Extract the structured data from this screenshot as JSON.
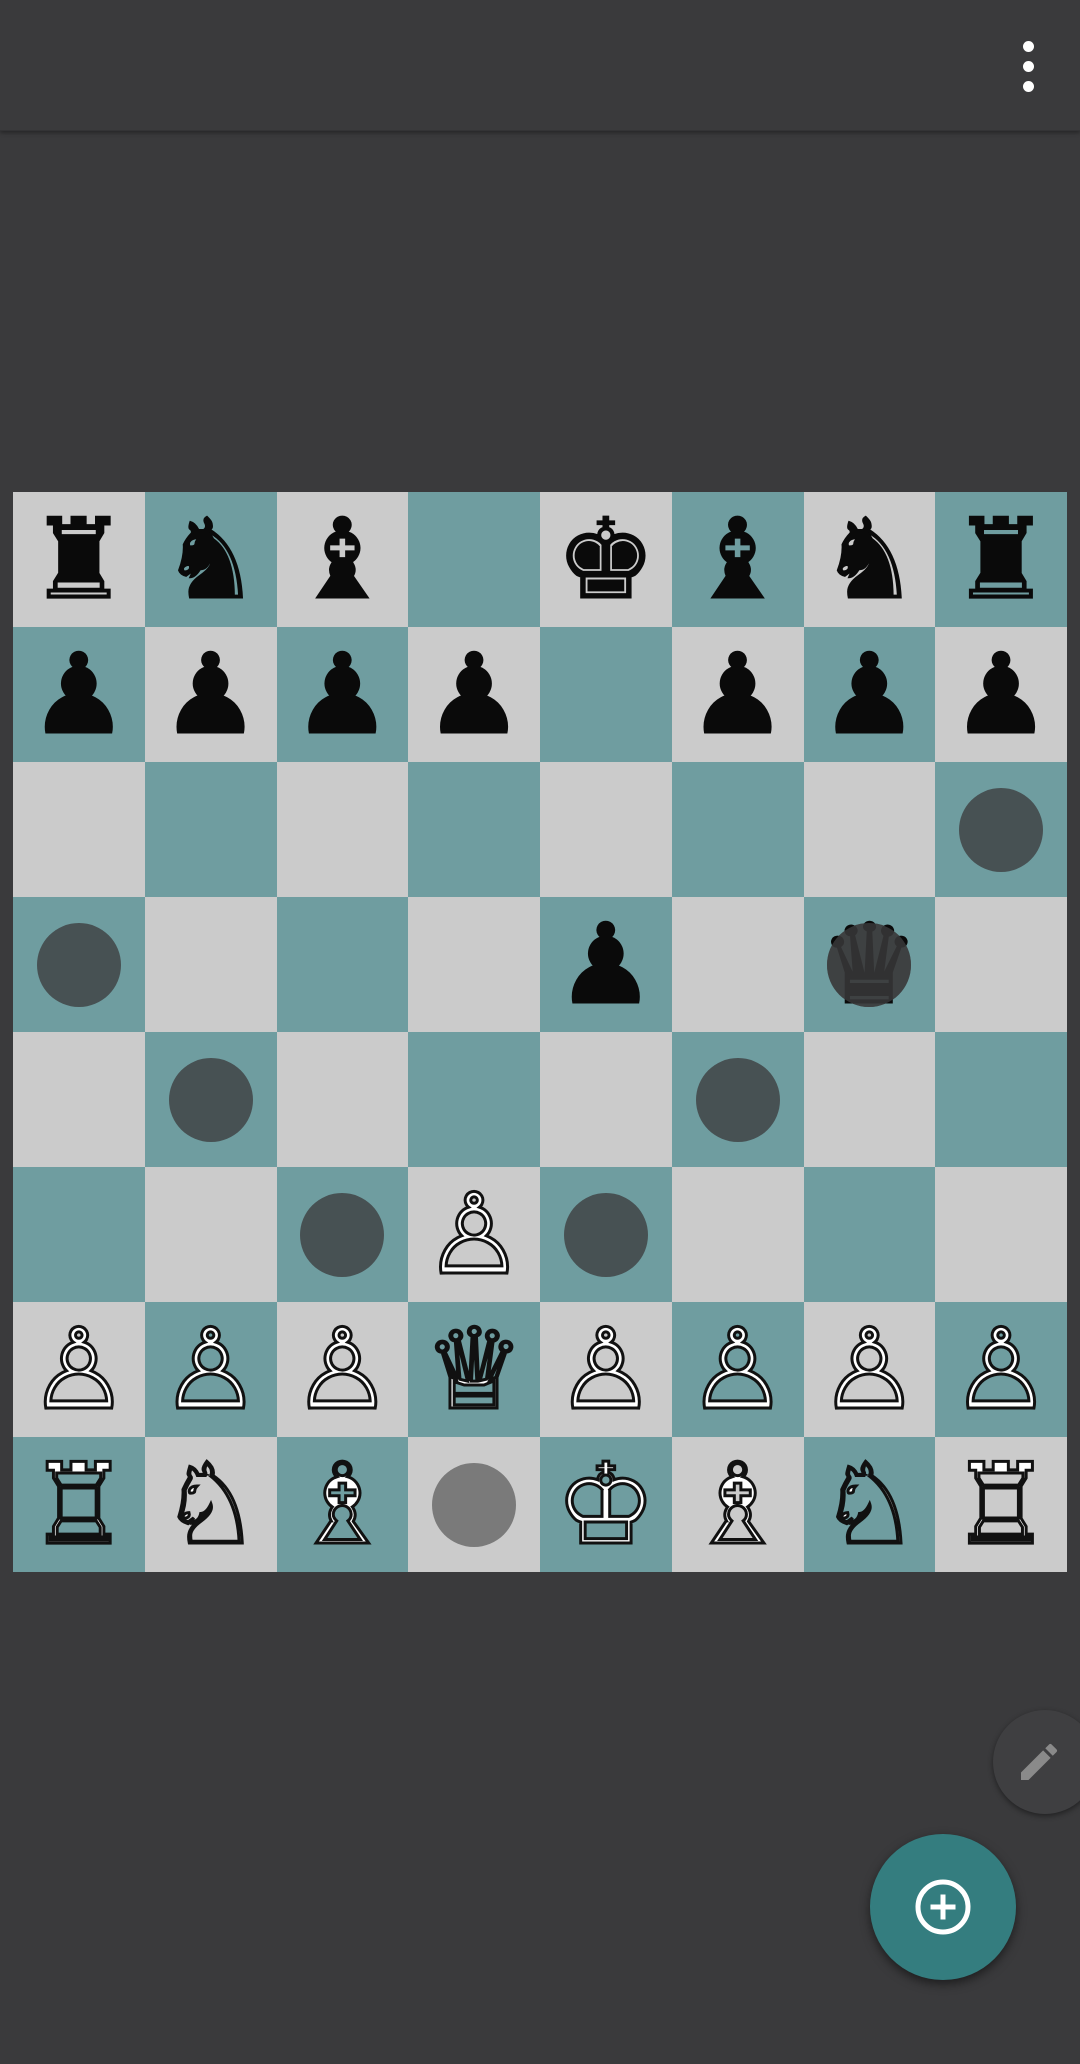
{
  "app_bar": {
    "menu_icon": "more-vert-icon"
  },
  "colors": {
    "light_square": "#cbcbcb",
    "dark_square": "#6f9da0",
    "accent": "#347d7f"
  },
  "board": {
    "rows": [
      [
        "♜",
        "♞",
        "♝",
        "",
        "♚",
        "♝",
        "♞",
        "♜"
      ],
      [
        "♟",
        "♟",
        "♟",
        "♟",
        "",
        "♟",
        "♟",
        "♟"
      ],
      [
        "",
        "",
        "",
        "",
        "",
        "",
        "",
        ""
      ],
      [
        "",
        "",
        "",
        "",
        "♟",
        "",
        "♛",
        ""
      ],
      [
        "",
        "",
        "",
        "",
        "",
        "",
        "",
        ""
      ],
      [
        "",
        "",
        "",
        "♙",
        "",
        "",
        "",
        ""
      ],
      [
        "♙",
        "♙",
        "♙",
        "♕",
        "♙",
        "♙",
        "♙",
        "♙"
      ],
      [
        "♖",
        "♘",
        "♗",
        "",
        "♔",
        "♗",
        "♘",
        "♖"
      ]
    ],
    "move_targets": [
      "h6",
      "a5",
      "g5",
      "b4",
      "f4",
      "c3",
      "e3",
      "d1"
    ],
    "selected_piece_square": "g5"
  },
  "fabs": {
    "edit_icon": "pencil-icon",
    "add_icon": "add-circle-icon"
  }
}
